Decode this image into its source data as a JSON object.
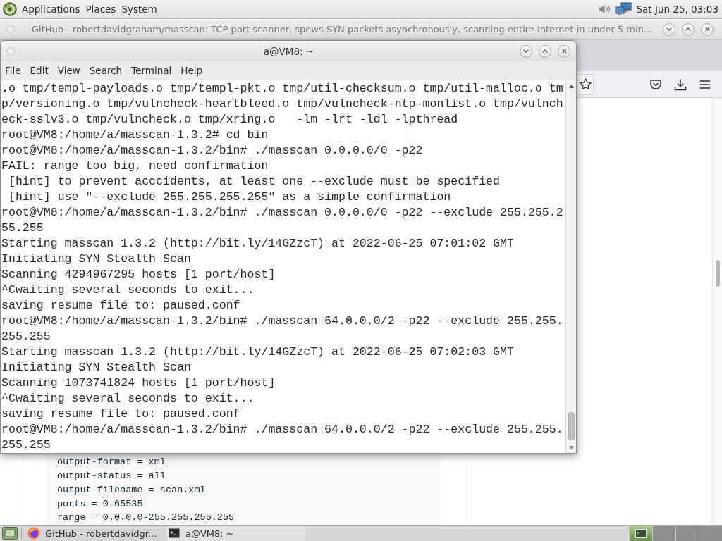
{
  "top_panel": {
    "menus": [
      "Applications",
      "Places",
      "System"
    ],
    "clock": "Sat Jun 25, 03:03"
  },
  "browser": {
    "title": "GitHub - robertdavidgraham/masscan: TCP port scanner, spews SYN packets asynchronously, scanning entire Internet in under 5 min...",
    "active": false,
    "code_lines": [
      "output-format = xml",
      "output-status = all",
      "output-filename = scan.xml",
      "ports = 0-65535",
      "range = 0.0.0.0-255.255.255.255"
    ]
  },
  "terminal": {
    "title": "a@VM8: ~",
    "active": true,
    "menu": [
      "File",
      "Edit",
      "View",
      "Search",
      "Terminal",
      "Help"
    ],
    "lines": [
      ".o tmp/templ-payloads.o tmp/templ-pkt.o tmp/util-checksum.o tmp/util-malloc.o tm",
      "p/versioning.o tmp/vulncheck-heartbleed.o tmp/vulncheck-ntp-monlist.o tmp/vulnch",
      "eck-sslv3.o tmp/vulncheck.o tmp/xring.o   -lm -lrt -ldl -lpthread",
      "root@VM8:/home/a/masscan-1.3.2# cd bin",
      "root@VM8:/home/a/masscan-1.3.2/bin# ./masscan 0.0.0.0/0 -p22",
      "FAIL: range too big, need confirmation",
      " [hint] to prevent acccidents, at least one --exclude must be specified",
      " [hint] use \"--exclude 255.255.255.255\" as a simple confirmation",
      "root@VM8:/home/a/masscan-1.3.2/bin# ./masscan 0.0.0.0/0 -p22 --exclude 255.255.2",
      "55.255",
      "Starting masscan 1.3.2 (http://bit.ly/14GZzcT) at 2022-06-25 07:01:02 GMT",
      "Initiating SYN Stealth Scan",
      "Scanning 4294967295 hosts [1 port/host]",
      "^Cwaiting several seconds to exit...",
      "saving resume file to: paused.conf",
      "root@VM8:/home/a/masscan-1.3.2/bin# ./masscan 64.0.0.0/2 -p22 --exclude 255.255.",
      "255.255",
      "Starting masscan 1.3.2 (http://bit.ly/14GZzcT) at 2022-06-25 07:02:03 GMT",
      "Initiating SYN Stealth Scan",
      "Scanning 1073741824 hosts [1 port/host]",
      "^Cwaiting several seconds to exit...",
      "saving resume file to: paused.conf",
      "root@VM8:/home/a/masscan-1.3.2/bin# ./masscan 64.0.0.0/2 -p22 --exclude 255.255.",
      "255.255"
    ]
  },
  "taskbar": {
    "tasks": [
      {
        "kind": "browser",
        "label": "GitHub - robertdavidgr...",
        "selected": false
      },
      {
        "kind": "terminal",
        "label": "a@VM8: ~",
        "selected": true
      }
    ],
    "workspaces": [
      {
        "selected": true
      },
      {
        "selected": false
      },
      {
        "selected": false
      },
      {
        "selected": false
      }
    ]
  }
}
